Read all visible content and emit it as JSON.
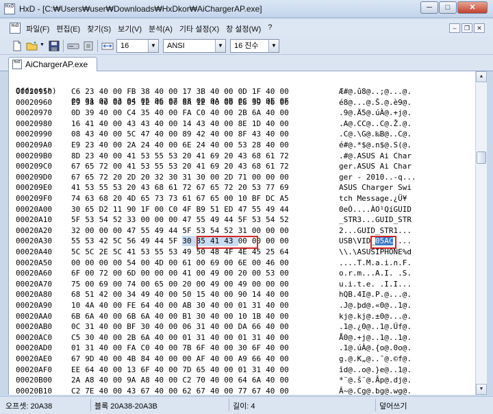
{
  "window": {
    "app_name": "HxD",
    "title_path": "[C:₩Users₩user₩Downloads₩HxDkor₩AiChargerAP.exe]",
    "buttons": [
      "minimize",
      "maximize",
      "close"
    ]
  },
  "menu": {
    "items": [
      "파일(F)",
      "편집(E)",
      "찾기(S)",
      "보기(V)",
      "분석(A)",
      "기타 설정(X)",
      "창 설정(W)",
      "?"
    ]
  },
  "toolbar": {
    "bytes_per_row": "16",
    "charset": "ANSI",
    "offset_base": "16 진수"
  },
  "tab": {
    "label": "AiChargerAP.exe"
  },
  "hex": {
    "header_offset": "Offset(h)",
    "header_columns": [
      "00",
      "01",
      "02",
      "03",
      "04",
      "05",
      "06",
      "07",
      "08",
      "09",
      "0A",
      "0B",
      "0C",
      "0D",
      "0E",
      "0F"
    ],
    "rows": [
      {
        "off": "00020950",
        "bytes": [
          "C6",
          "23",
          "40",
          "00",
          "FB",
          "38",
          "40",
          "00",
          "17",
          "3B",
          "40",
          "00",
          "0D",
          "1F",
          "40",
          "00"
        ],
        "ascii": "Æ#@.û8@..;@...@."
      },
      {
        "off": "00020960",
        "bytes": [
          "E9",
          "38",
          "40",
          "00",
          "05",
          "1E",
          "40",
          "00",
          "8A",
          "1E",
          "40",
          "00",
          "E8",
          "39",
          "40",
          "00"
        ],
        "ascii": "é8@...@.Š.@.è9@."
      },
      {
        "off": "00020970",
        "bytes": [
          "0D",
          "39",
          "40",
          "00",
          "C4",
          "35",
          "40",
          "00",
          "FA",
          "C0",
          "40",
          "00",
          "2B",
          "6A",
          "40",
          "00"
        ],
        "ascii": ".9@.Ä5@.úÀ@.+j@."
      },
      {
        "off": "00020980",
        "bytes": [
          "16",
          "41",
          "40",
          "00",
          "43",
          "43",
          "40",
          "00",
          "14",
          "43",
          "40",
          "00",
          "8E",
          "1D",
          "40",
          "00"
        ],
        "ascii": ".A@.CC@..C@.Ž.@."
      },
      {
        "off": "00020990",
        "bytes": [
          "08",
          "43",
          "40",
          "00",
          "5C",
          "47",
          "40",
          "00",
          "89",
          "42",
          "40",
          "00",
          "8F",
          "43",
          "40",
          "00"
        ],
        "ascii": ".C@.\\G@.‰B@..C@."
      },
      {
        "off": "000209A0",
        "bytes": [
          "E9",
          "23",
          "40",
          "00",
          "2A",
          "24",
          "40",
          "00",
          "6E",
          "24",
          "40",
          "00",
          "53",
          "28",
          "40",
          "00"
        ],
        "ascii": "é#@.*$@.n$@.S(@."
      },
      {
        "off": "000209B0",
        "bytes": [
          "8D",
          "23",
          "40",
          "00",
          "41",
          "53",
          "55",
          "53",
          "20",
          "41",
          "69",
          "20",
          "43",
          "68",
          "61",
          "72"
        ],
        "ascii": ".#@.ASUS Ai Char"
      },
      {
        "off": "000209C0",
        "bytes": [
          "67",
          "65",
          "72",
          "00",
          "41",
          "53",
          "55",
          "53",
          "20",
          "41",
          "69",
          "20",
          "43",
          "68",
          "61",
          "72"
        ],
        "ascii": "ger.ASUS Ai Char"
      },
      {
        "off": "000209D0",
        "bytes": [
          "67",
          "65",
          "72",
          "20",
          "2D",
          "20",
          "32",
          "30",
          "31",
          "30",
          "00",
          "2D",
          "71",
          "00",
          "00",
          "00"
        ],
        "ascii": "ger - 2010..-q..."
      },
      {
        "off": "000209E0",
        "bytes": [
          "41",
          "53",
          "55",
          "53",
          "20",
          "43",
          "68",
          "61",
          "72",
          "67",
          "65",
          "72",
          "20",
          "53",
          "77",
          "69"
        ],
        "ascii": "ASUS Charger Swi"
      },
      {
        "off": "000209F0",
        "bytes": [
          "74",
          "63",
          "68",
          "20",
          "4D",
          "65",
          "73",
          "73",
          "61",
          "67",
          "65",
          "00",
          "10",
          "BF",
          "DC",
          "A5"
        ],
        "ascii": "tch Message.¿Ü¥"
      },
      {
        "off": "00020A00",
        "bytes": [
          "30",
          "65",
          "D2",
          "11",
          "90",
          "1F",
          "00",
          "C0",
          "4F",
          "B9",
          "51",
          "ED",
          "47",
          "55",
          "49",
          "44"
        ],
        "ascii": "0eÒ....ÀO¹QíGUID"
      },
      {
        "off": "00020A10",
        "bytes": [
          "5F",
          "53",
          "54",
          "52",
          "33",
          "00",
          "00",
          "00",
          "47",
          "55",
          "49",
          "44",
          "5F",
          "53",
          "54",
          "52"
        ],
        "ascii": "_STR3...GUID_STR"
      },
      {
        "off": "00020A20",
        "bytes": [
          "32",
          "00",
          "00",
          "00",
          "47",
          "55",
          "49",
          "44",
          "5F",
          "53",
          "54",
          "52",
          "31",
          "00",
          "00",
          "00"
        ],
        "ascii": "2...GUID_STR1..."
      },
      {
        "off": "00020A30",
        "bytes": [
          "55",
          "53",
          "42",
          "5C",
          "56",
          "49",
          "44",
          "5F",
          "30",
          "35",
          "41",
          "43",
          "00",
          "00",
          "00",
          "00"
        ],
        "ascii": "USB\\VID_05AC...."
      },
      {
        "off": "00020A40",
        "bytes": [
          "5C",
          "5C",
          "2E",
          "5C",
          "41",
          "53",
          "55",
          "53",
          "49",
          "50",
          "48",
          "4F",
          "4E",
          "45",
          "25",
          "64"
        ],
        "ascii": "\\\\.\\ASUSIPHONE%d"
      },
      {
        "off": "00020A50",
        "bytes": [
          "00",
          "00",
          "00",
          "00",
          "54",
          "00",
          "4D",
          "00",
          "61",
          "00",
          "69",
          "00",
          "6E",
          "00",
          "46",
          "00"
        ],
        "ascii": "....T.M.a.i.n.F."
      },
      {
        "off": "00020A60",
        "bytes": [
          "6F",
          "00",
          "72",
          "00",
          "6D",
          "00",
          "00",
          "00",
          "41",
          "00",
          "49",
          "00",
          "20",
          "00",
          "53",
          "00"
        ],
        "ascii": "o.r.m...A.I. .S."
      },
      {
        "off": "00020A70",
        "bytes": [
          "75",
          "00",
          "69",
          "00",
          "74",
          "00",
          "65",
          "00",
          "20",
          "00",
          "49",
          "00",
          "49",
          "00",
          "00",
          "00"
        ],
        "ascii": "u.i.t.e. .I.I..."
      },
      {
        "off": "00020A80",
        "bytes": [
          "68",
          "51",
          "42",
          "00",
          "34",
          "49",
          "40",
          "00",
          "50",
          "15",
          "40",
          "00",
          "90",
          "14",
          "40",
          "00"
        ],
        "ascii": "hQB.4I@.P.@...@."
      },
      {
        "off": "00020A90",
        "bytes": [
          "10",
          "4A",
          "40",
          "00",
          "FE",
          "64",
          "40",
          "00",
          "AB",
          "30",
          "40",
          "00",
          "01",
          "31",
          "40",
          "00"
        ],
        "ascii": ".J@.þd@.«0@..1@."
      },
      {
        "off": "00020AA0",
        "bytes": [
          "6B",
          "6A",
          "40",
          "00",
          "6B",
          "6A",
          "40",
          "00",
          "B1",
          "30",
          "40",
          "00",
          "10",
          "1B",
          "40",
          "00"
        ],
        "ascii": "kj@.kj@.±0@...@."
      },
      {
        "off": "00020AB0",
        "bytes": [
          "0C",
          "31",
          "40",
          "00",
          "BF",
          "30",
          "40",
          "00",
          "06",
          "31",
          "40",
          "00",
          "DA",
          "66",
          "40",
          "00"
        ],
        "ascii": ".1@.¿0@..1@.Úf@."
      },
      {
        "off": "00020AC0",
        "bytes": [
          "C5",
          "30",
          "40",
          "00",
          "2B",
          "6A",
          "40",
          "00",
          "01",
          "31",
          "40",
          "00",
          "01",
          "31",
          "40",
          "00"
        ],
        "ascii": "Å0@.+j@..1@..1@."
      },
      {
        "off": "00020AD0",
        "bytes": [
          "01",
          "31",
          "40",
          "00",
          "FA",
          "C0",
          "40",
          "00",
          "7B",
          "6F",
          "40",
          "00",
          "30",
          "6F",
          "40",
          "00"
        ],
        "ascii": ".1@.úÀ@.{o@.0o@."
      },
      {
        "off": "00020AE0",
        "bytes": [
          "67",
          "9D",
          "40",
          "00",
          "4B",
          "84",
          "40",
          "00",
          "00",
          "AF",
          "40",
          "00",
          "A9",
          "66",
          "40",
          "00"
        ],
        "ascii": "g.@.K„@..¯@.©f@."
      },
      {
        "off": "00020AF0",
        "bytes": [
          "EE",
          "64",
          "40",
          "00",
          "13",
          "6F",
          "40",
          "00",
          "7D",
          "65",
          "40",
          "00",
          "01",
          "31",
          "40",
          "00"
        ],
        "ascii": "îd@..o@.}e@..1@."
      },
      {
        "off": "00020B00",
        "bytes": [
          "2A",
          "A8",
          "40",
          "00",
          "9A",
          "A8",
          "40",
          "00",
          "C2",
          "70",
          "40",
          "00",
          "64",
          "6A",
          "40",
          "00"
        ],
        "ascii": "*¨@.š¨@.Âp@.dj@."
      },
      {
        "off": "00020B10",
        "bytes": [
          "C2",
          "7E",
          "40",
          "00",
          "43",
          "67",
          "40",
          "00",
          "62",
          "67",
          "40",
          "00",
          "77",
          "67",
          "40",
          "00"
        ],
        "ascii": "Â~@.Cg@.bg@.wg@."
      }
    ],
    "selected_hex": "30 35 41 43",
    "selected_ascii": "05AC"
  },
  "status": {
    "offset_label": "오프셋: 20A38",
    "block_label": "블록 20A38-20A3B",
    "length_label": "길이: 4",
    "mode_label": "덮어쓰기"
  }
}
